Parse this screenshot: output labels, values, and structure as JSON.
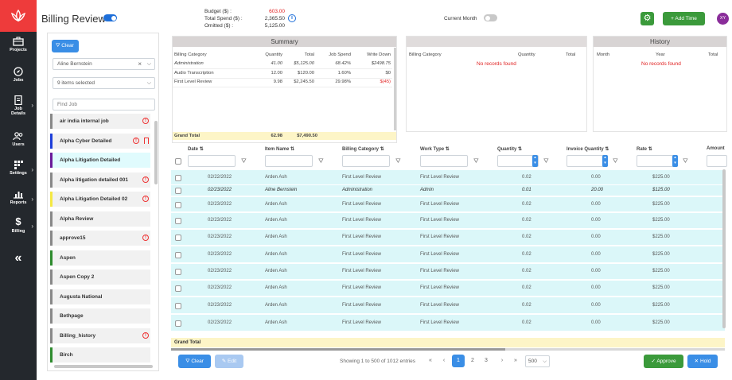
{
  "nav": {
    "items": [
      {
        "label": "Projects"
      },
      {
        "label": "Jobs"
      },
      {
        "label": "Job Details"
      },
      {
        "label": "Users"
      },
      {
        "label": "Settings"
      },
      {
        "label": "Reports"
      },
      {
        "label": "Billing"
      }
    ],
    "collapse": "«"
  },
  "header": {
    "title": "Billing Review",
    "budget_label": "Budget ($) :",
    "budget_value": "603.00",
    "spend_label": "Total Spend ($) :",
    "spend_value": "2,365.50",
    "omitted_label": "Omitted ($) :",
    "omitted_value": "5,125.00",
    "current_month": "Current Month",
    "add_time": "Add Time",
    "avatar": "XY",
    "budget_color": "#e02020"
  },
  "jobs": {
    "clear": "Clear",
    "user_select": "Aline Bernstein",
    "items_select": "9 items selected",
    "find_placeholder": "Find Job",
    "list": [
      {
        "name": "air india internal job",
        "color": "#888888",
        "alert": true,
        "bookmark": false,
        "active": false
      },
      {
        "name": "Alpha Cyber Detailed",
        "color": "#1e3fd9",
        "alert": true,
        "bookmark": true,
        "active": false
      },
      {
        "name": "Alpha Litigation Detailed",
        "color": "#6a1b9a",
        "alert": false,
        "bookmark": false,
        "active": true
      },
      {
        "name": "Alpha litigation detailed 001",
        "color": "#888888",
        "alert": true,
        "bookmark": false,
        "active": false
      },
      {
        "name": "Alpha Litigation Detailed 02",
        "color": "#f4e842",
        "alert": true,
        "bookmark": false,
        "active": false
      },
      {
        "name": "Alpha Review",
        "color": "#888888",
        "alert": false,
        "bookmark": false,
        "active": false
      },
      {
        "name": "approve15",
        "color": "#888888",
        "alert": true,
        "bookmark": false,
        "active": false
      },
      {
        "name": "Aspen",
        "color": "#2e8b2e",
        "alert": false,
        "bookmark": false,
        "active": false
      },
      {
        "name": "Aspen Copy 2",
        "color": "#888888",
        "alert": false,
        "bookmark": false,
        "active": false
      },
      {
        "name": "Augusta National",
        "color": "#888888",
        "alert": false,
        "bookmark": false,
        "active": false
      },
      {
        "name": "Bethpage",
        "color": "#888888",
        "alert": false,
        "bookmark": false,
        "active": false
      },
      {
        "name": "Billing_history",
        "color": "#888888",
        "alert": true,
        "bookmark": false,
        "active": false
      },
      {
        "name": "Birch",
        "color": "#2e8b2e",
        "alert": false,
        "bookmark": false,
        "active": false
      }
    ]
  },
  "summary": {
    "title": "Summary",
    "headers": [
      "Billing Category",
      "Quantity",
      "Total",
      "Job Spend",
      "Write Down"
    ],
    "rows": [
      {
        "cat": "Administration",
        "qty": "41.00",
        "total": "$5,125.00",
        "spend": "68.42%",
        "wd": "$2498.75",
        "italic": true,
        "red": false
      },
      {
        "cat": "Audio Transcription",
        "qty": "12.00",
        "total": "$120.00",
        "spend": "1.60%",
        "wd": "$0",
        "italic": false,
        "red": false
      },
      {
        "cat": "First Level Review",
        "qty": "9.98",
        "total": "$2,245.50",
        "spend": "29.98%",
        "wd": "$(45)",
        "italic": false,
        "red": true
      }
    ],
    "grand_label": "Grand Total",
    "grand_qty": "62.98",
    "grand_total": "$7,490.50"
  },
  "billing_cat": {
    "headers": [
      "Billing Category",
      "Quantity",
      "Total"
    ],
    "empty": "No records found"
  },
  "history": {
    "title": "History",
    "headers": [
      "Month",
      "Year",
      "Total"
    ],
    "empty": "No records found"
  },
  "grid": {
    "headers": [
      "Date",
      "Item Name",
      "Billing Category",
      "Work Type",
      "Quantity",
      "Invoice Quantity",
      "Rate",
      "Amount"
    ],
    "rows": [
      {
        "date": "02/22/2022",
        "item": "Arden Ash",
        "cat": "First Level Review",
        "work": "First Level Review",
        "qty": "0.02",
        "inv": "0.00",
        "rate": "$225.00",
        "italic": false
      },
      {
        "date": "02/23/2022",
        "item": "Aline Bernstein",
        "cat": "Administration",
        "work": "Admin",
        "qty": "0.01",
        "inv": "20.00",
        "rate": "$125.00",
        "italic": true
      },
      {
        "date": "02/23/2022",
        "item": "Arden Ash",
        "cat": "First Level Review",
        "work": "First Level Review",
        "qty": "0.02",
        "inv": "0.00",
        "rate": "$225.00",
        "italic": false
      },
      {
        "date": "02/23/2022",
        "item": "Arden Ash",
        "cat": "First Level Review",
        "work": "First Level Review",
        "qty": "0.02",
        "inv": "0.00",
        "rate": "$225.00",
        "italic": false
      },
      {
        "date": "02/23/2022",
        "item": "Arden Ash",
        "cat": "First Level Review",
        "work": "First Level Review",
        "qty": "0.02",
        "inv": "0.00",
        "rate": "$225.00",
        "italic": false
      },
      {
        "date": "02/23/2022",
        "item": "Arden Ash",
        "cat": "First Level Review",
        "work": "First Level Review",
        "qty": "0.02",
        "inv": "0.00",
        "rate": "$225.00",
        "italic": false
      },
      {
        "date": "02/23/2022",
        "item": "Arden Ash",
        "cat": "First Level Review",
        "work": "First Level Review",
        "qty": "0.02",
        "inv": "0.00",
        "rate": "$225.00",
        "italic": false
      },
      {
        "date": "02/23/2022",
        "item": "Arden Ash",
        "cat": "First Level Review",
        "work": "First Level Review",
        "qty": "0.02",
        "inv": "0.00",
        "rate": "$225.00",
        "italic": false
      },
      {
        "date": "02/23/2022",
        "item": "Arden Ash",
        "cat": "First Level Review",
        "work": "First Level Review",
        "qty": "0.02",
        "inv": "0.00",
        "rate": "$225.00",
        "italic": false
      },
      {
        "date": "02/23/2022",
        "item": "Arden Ash",
        "cat": "First Level Review",
        "work": "First Level Review",
        "qty": "0.02",
        "inv": "0.00",
        "rate": "$225.00",
        "italic": false
      }
    ],
    "grand_label": "Grand Total"
  },
  "footer": {
    "clear": "Clear",
    "edit": "Edit",
    "paging": "Showing 1 to 500 of 1012 entries",
    "first": "«",
    "prev": "‹",
    "pages": [
      "1",
      "2",
      "3"
    ],
    "next": "›",
    "last": "»",
    "page_size": "500",
    "approve": "Approve",
    "hold": "Hold"
  }
}
